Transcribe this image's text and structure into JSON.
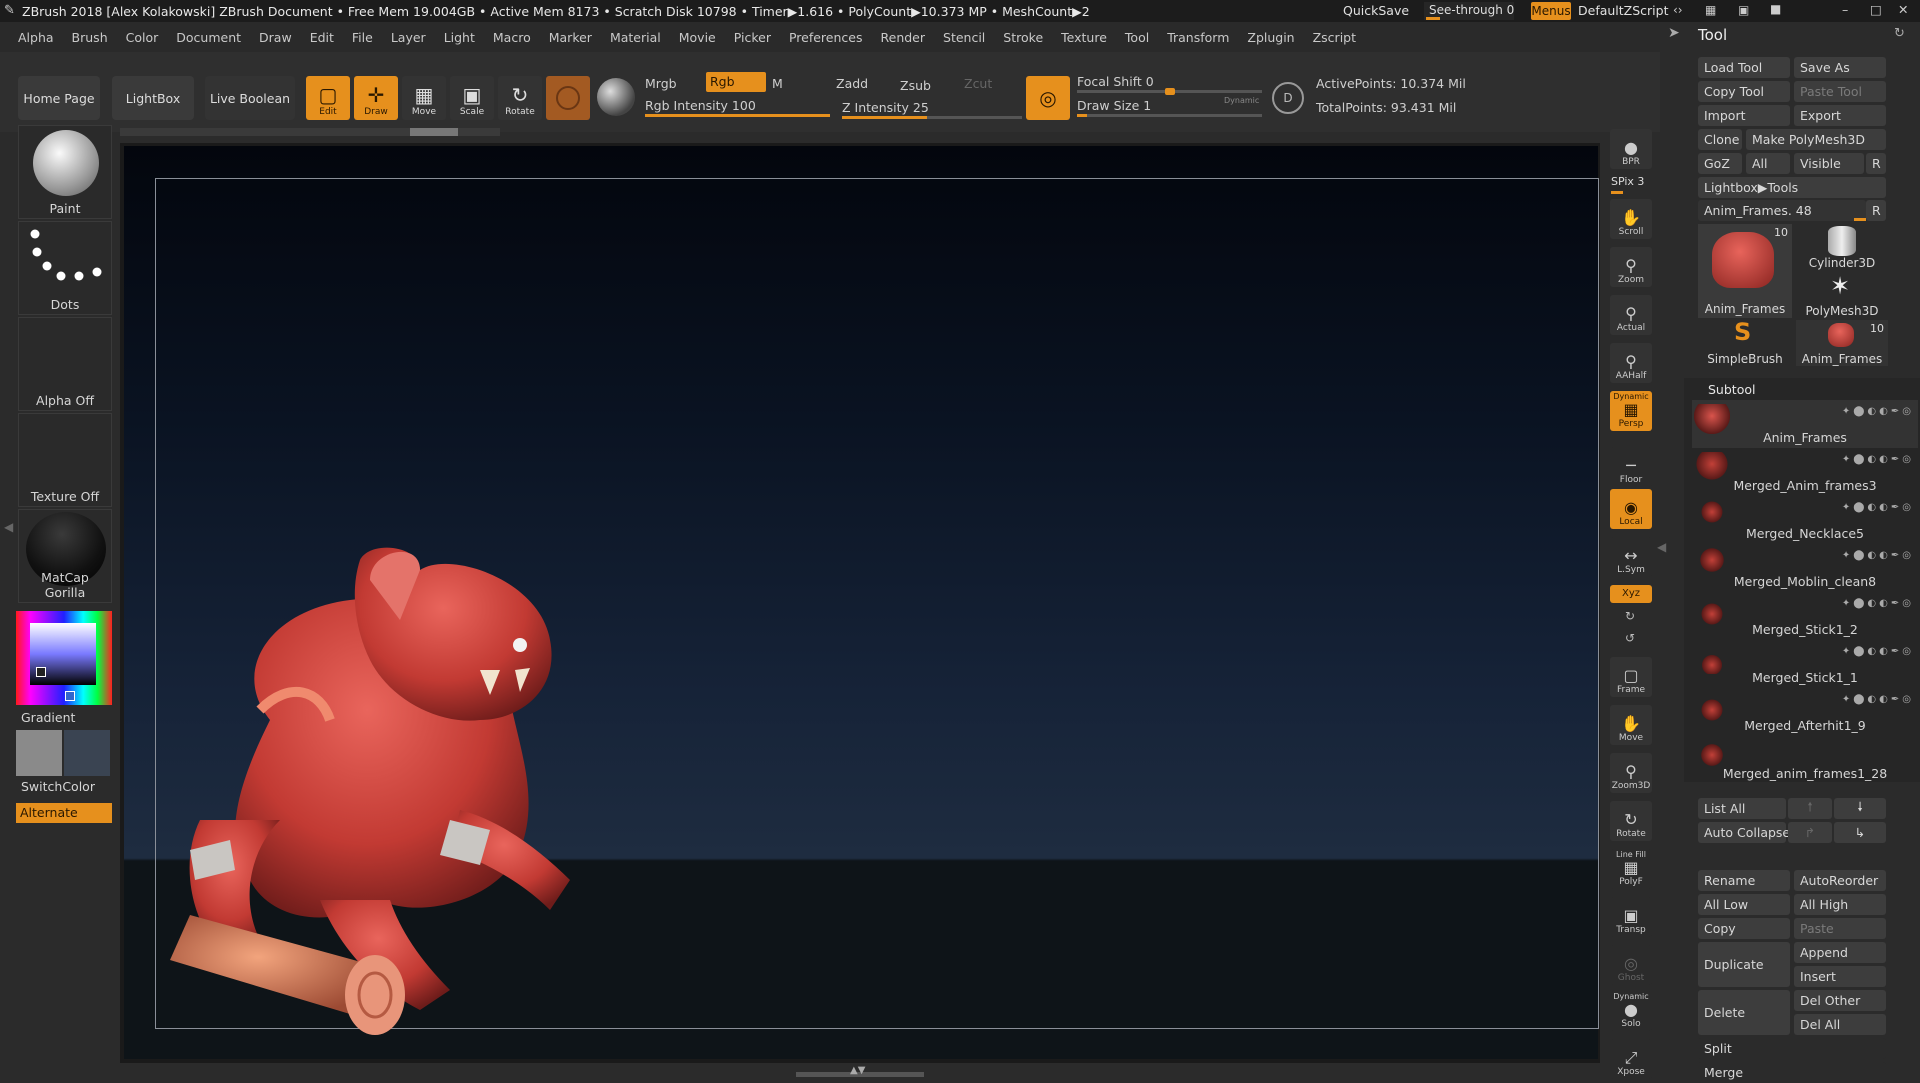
{
  "titlebar": {
    "title": "ZBrush 2018 [Alex Kolakowski]   ZBrush Document     • Free Mem 19.004GB • Active Mem 8173 • Scratch Disk 10798 • Timer▶1.616 • PolyCount▶10.373 MP   • MeshCount▶2",
    "quicksave": "QuickSave",
    "seethrough": "See-through  0",
    "menus": "Menus",
    "script": "DefaultZScript"
  },
  "menu": [
    "Alpha",
    "Brush",
    "Color",
    "Document",
    "Draw",
    "Edit",
    "File",
    "Layer",
    "Light",
    "Macro",
    "Marker",
    "Material",
    "Movie",
    "Picker",
    "Preferences",
    "Render",
    "Stencil",
    "Stroke",
    "Texture",
    "Tool",
    "Transform",
    "Zplugin",
    "Zscript"
  ],
  "shelf": {
    "home": "Home Page",
    "lightbox": "LightBox",
    "liveboolean": "Live Boolean",
    "edit": "Edit",
    "draw": "Draw",
    "move": "Move",
    "scale": "Scale",
    "rotate": "Rotate",
    "mrgb": "Mrgb",
    "rgb": "Rgb",
    "m": "M",
    "zadd": "Zadd",
    "zsub": "Zsub",
    "zcut": "Zcut",
    "rgb_intensity": "Rgb Intensity 100",
    "z_intensity": "Z Intensity 25",
    "focal_shift": "Focal Shift 0",
    "draw_size": "Draw Size 1",
    "dynamic": "Dynamic",
    "active_points": "ActivePoints: 10.374 Mil",
    "total_points": "TotalPoints: 93.431 Mil"
  },
  "left": {
    "paint": "Paint",
    "dots": "Dots",
    "alpha": "Alpha Off",
    "texture": "Texture Off",
    "matcap": "MatCap Gorilla",
    "gradient": "Gradient",
    "switchcolor": "SwitchColor",
    "alternate": "Alternate"
  },
  "rightstrip": {
    "bpr": "BPR",
    "spix": "SPix 3",
    "scroll": "Scroll",
    "zoom": "Zoom",
    "actual": "Actual",
    "aahalf": "AAHalf",
    "persp": "Persp",
    "dynamic": "Dynamic",
    "floor": "Floor",
    "local": "Local",
    "lsym": "L.Sym",
    "xyz": "Xyz",
    "frame": "Frame",
    "move": "Move",
    "zoom3d": "Zoom3D",
    "rotate": "Rotate",
    "linefill": "Line Fill",
    "polyf": "PolyF",
    "transp": "Transp",
    "ghost": "Ghost",
    "dynamic2": "Dynamic",
    "solo": "Solo",
    "xpose": "Xpose"
  },
  "tool": {
    "title": "Tool",
    "load": "Load Tool",
    "saveas": "Save As",
    "copy": "Copy Tool",
    "paste": "Paste Tool",
    "import": "Import",
    "export": "Export",
    "clone": "Clone",
    "makepoly": "Make PolyMesh3D",
    "goz": "GoZ",
    "all": "All",
    "visible": "Visible",
    "r": "R",
    "lightboxtools": "Lightbox▶Tools",
    "animframes": "Anim_Frames. 48",
    "thumbs": [
      {
        "name": "Anim_Frames",
        "count": "10"
      },
      {
        "name": "Cylinder3D",
        "count": ""
      },
      {
        "name": "PolyMesh3D",
        "count": ""
      },
      {
        "name": "SimpleBrush",
        "count": ""
      },
      {
        "name": "Anim_Frames",
        "count": "10"
      }
    ],
    "subtool": "Subtool",
    "subtools": [
      "Anim_Frames",
      "Merged_Anim_frames3",
      "Merged_Necklace5",
      "Merged_Moblin_clean8",
      "Merged_Stick1_2",
      "Merged_Stick1_1",
      "Merged_Afterhit1_9",
      "Merged_anim_frames1_28"
    ],
    "listall": "List All",
    "autocollapse": "Auto Collapse",
    "rename": "Rename",
    "autoreorder": "AutoReorder",
    "alllow": "All Low",
    "allhigh": "All High",
    "copy2": "Copy",
    "paste2": "Paste",
    "duplicate": "Duplicate",
    "append": "Append",
    "insert": "Insert",
    "delete": "Delete",
    "delother": "Del Other",
    "delall": "Del All",
    "split": "Split",
    "merge": "Merge"
  },
  "colors": {
    "accent": "#e6901d",
    "skin": "#c8403a"
  }
}
